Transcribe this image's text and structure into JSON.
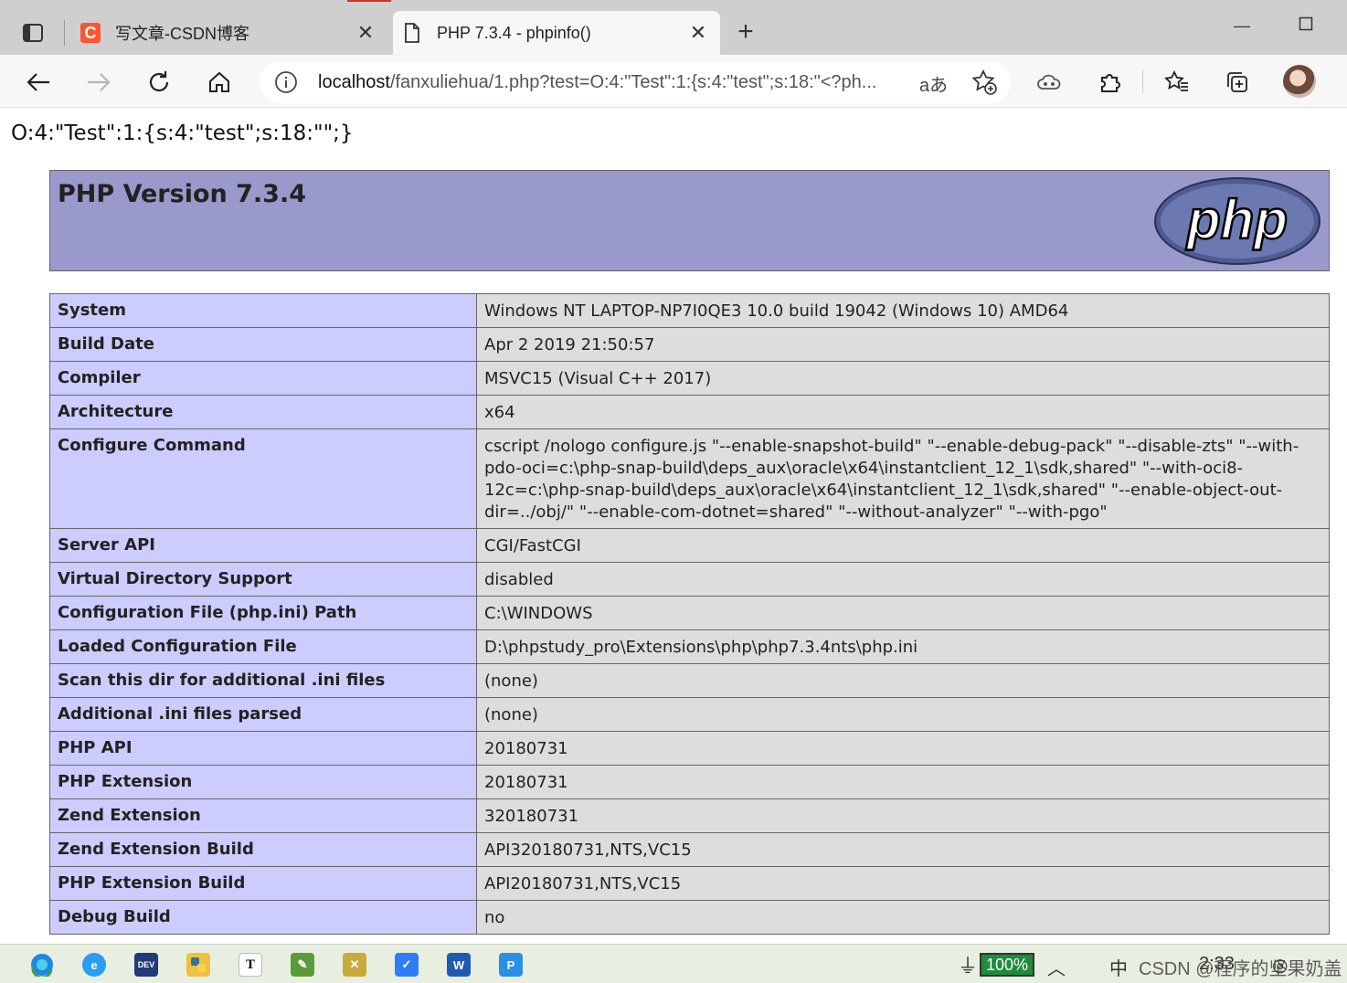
{
  "browser": {
    "tabs": [
      {
        "title": "写文章-CSDN博客",
        "favicon": "csdn-icon"
      },
      {
        "title": "PHP 7.3.4 - phpinfo()",
        "favicon": "page-icon"
      }
    ],
    "address": {
      "host": "localhost",
      "path": "/fanxuliehua/1.php?test=O:4:\"Test\":1:{s:4:\"test\";s:18:\"<?ph...",
      "read_aloud": "aあ"
    }
  },
  "page": {
    "echo_line": "O:4:\"Test\":1:{s:4:\"test\";s:18:\"\";}",
    "header_title": "PHP Version 7.3.4",
    "logo_text": "php",
    "rows": [
      {
        "label": "System",
        "value": "Windows NT LAPTOP-NP7I0QE3 10.0 build 19042 (Windows 10) AMD64"
      },
      {
        "label": "Build Date",
        "value": "Apr 2 2019 21:50:57"
      },
      {
        "label": "Compiler",
        "value": "MSVC15 (Visual C++ 2017)"
      },
      {
        "label": "Architecture",
        "value": "x64"
      },
      {
        "label": "Configure Command",
        "value": "cscript /nologo configure.js \"--enable-snapshot-build\" \"--enable-debug-pack\" \"--disable-zts\" \"--with-pdo-oci=c:\\php-snap-build\\deps_aux\\oracle\\x64\\instantclient_12_1\\sdk,shared\" \"--with-oci8-12c=c:\\php-snap-build\\deps_aux\\oracle\\x64\\instantclient_12_1\\sdk,shared\" \"--enable-object-out-dir=../obj/\" \"--enable-com-dotnet=shared\" \"--without-analyzer\" \"--with-pgo\""
      },
      {
        "label": "Server API",
        "value": "CGI/FastCGI"
      },
      {
        "label": "Virtual Directory Support",
        "value": "disabled"
      },
      {
        "label": "Configuration File (php.ini) Path",
        "value": "C:\\WINDOWS"
      },
      {
        "label": "Loaded Configuration File",
        "value": "D:\\phpstudy_pro\\Extensions\\php\\php7.3.4nts\\php.ini"
      },
      {
        "label": "Scan this dir for additional .ini files",
        "value": "(none)"
      },
      {
        "label": "Additional .ini files parsed",
        "value": "(none)"
      },
      {
        "label": "PHP API",
        "value": "20180731"
      },
      {
        "label": "PHP Extension",
        "value": "20180731"
      },
      {
        "label": "Zend Extension",
        "value": "320180731"
      },
      {
        "label": "Zend Extension Build",
        "value": "API320180731,NTS,VC15"
      },
      {
        "label": "PHP Extension Build",
        "value": "API20180731,NTS,VC15"
      },
      {
        "label": "Debug Build",
        "value": "no"
      }
    ]
  },
  "taskbar": {
    "battery": "100%",
    "ime": "中",
    "clock": "2:33",
    "watermark": "CSDN @程序的坚果奶盖",
    "app_labels": {
      "dev": "DEV",
      "typora": "T",
      "word": "W",
      "p": "P"
    }
  },
  "colors": {
    "php_header_bg": "#9999cc",
    "label_cell_bg": "#ccccff",
    "value_cell_bg": "#dddddd",
    "csdn_red": "#fc5531",
    "battery_green": "#1e8c3c"
  }
}
